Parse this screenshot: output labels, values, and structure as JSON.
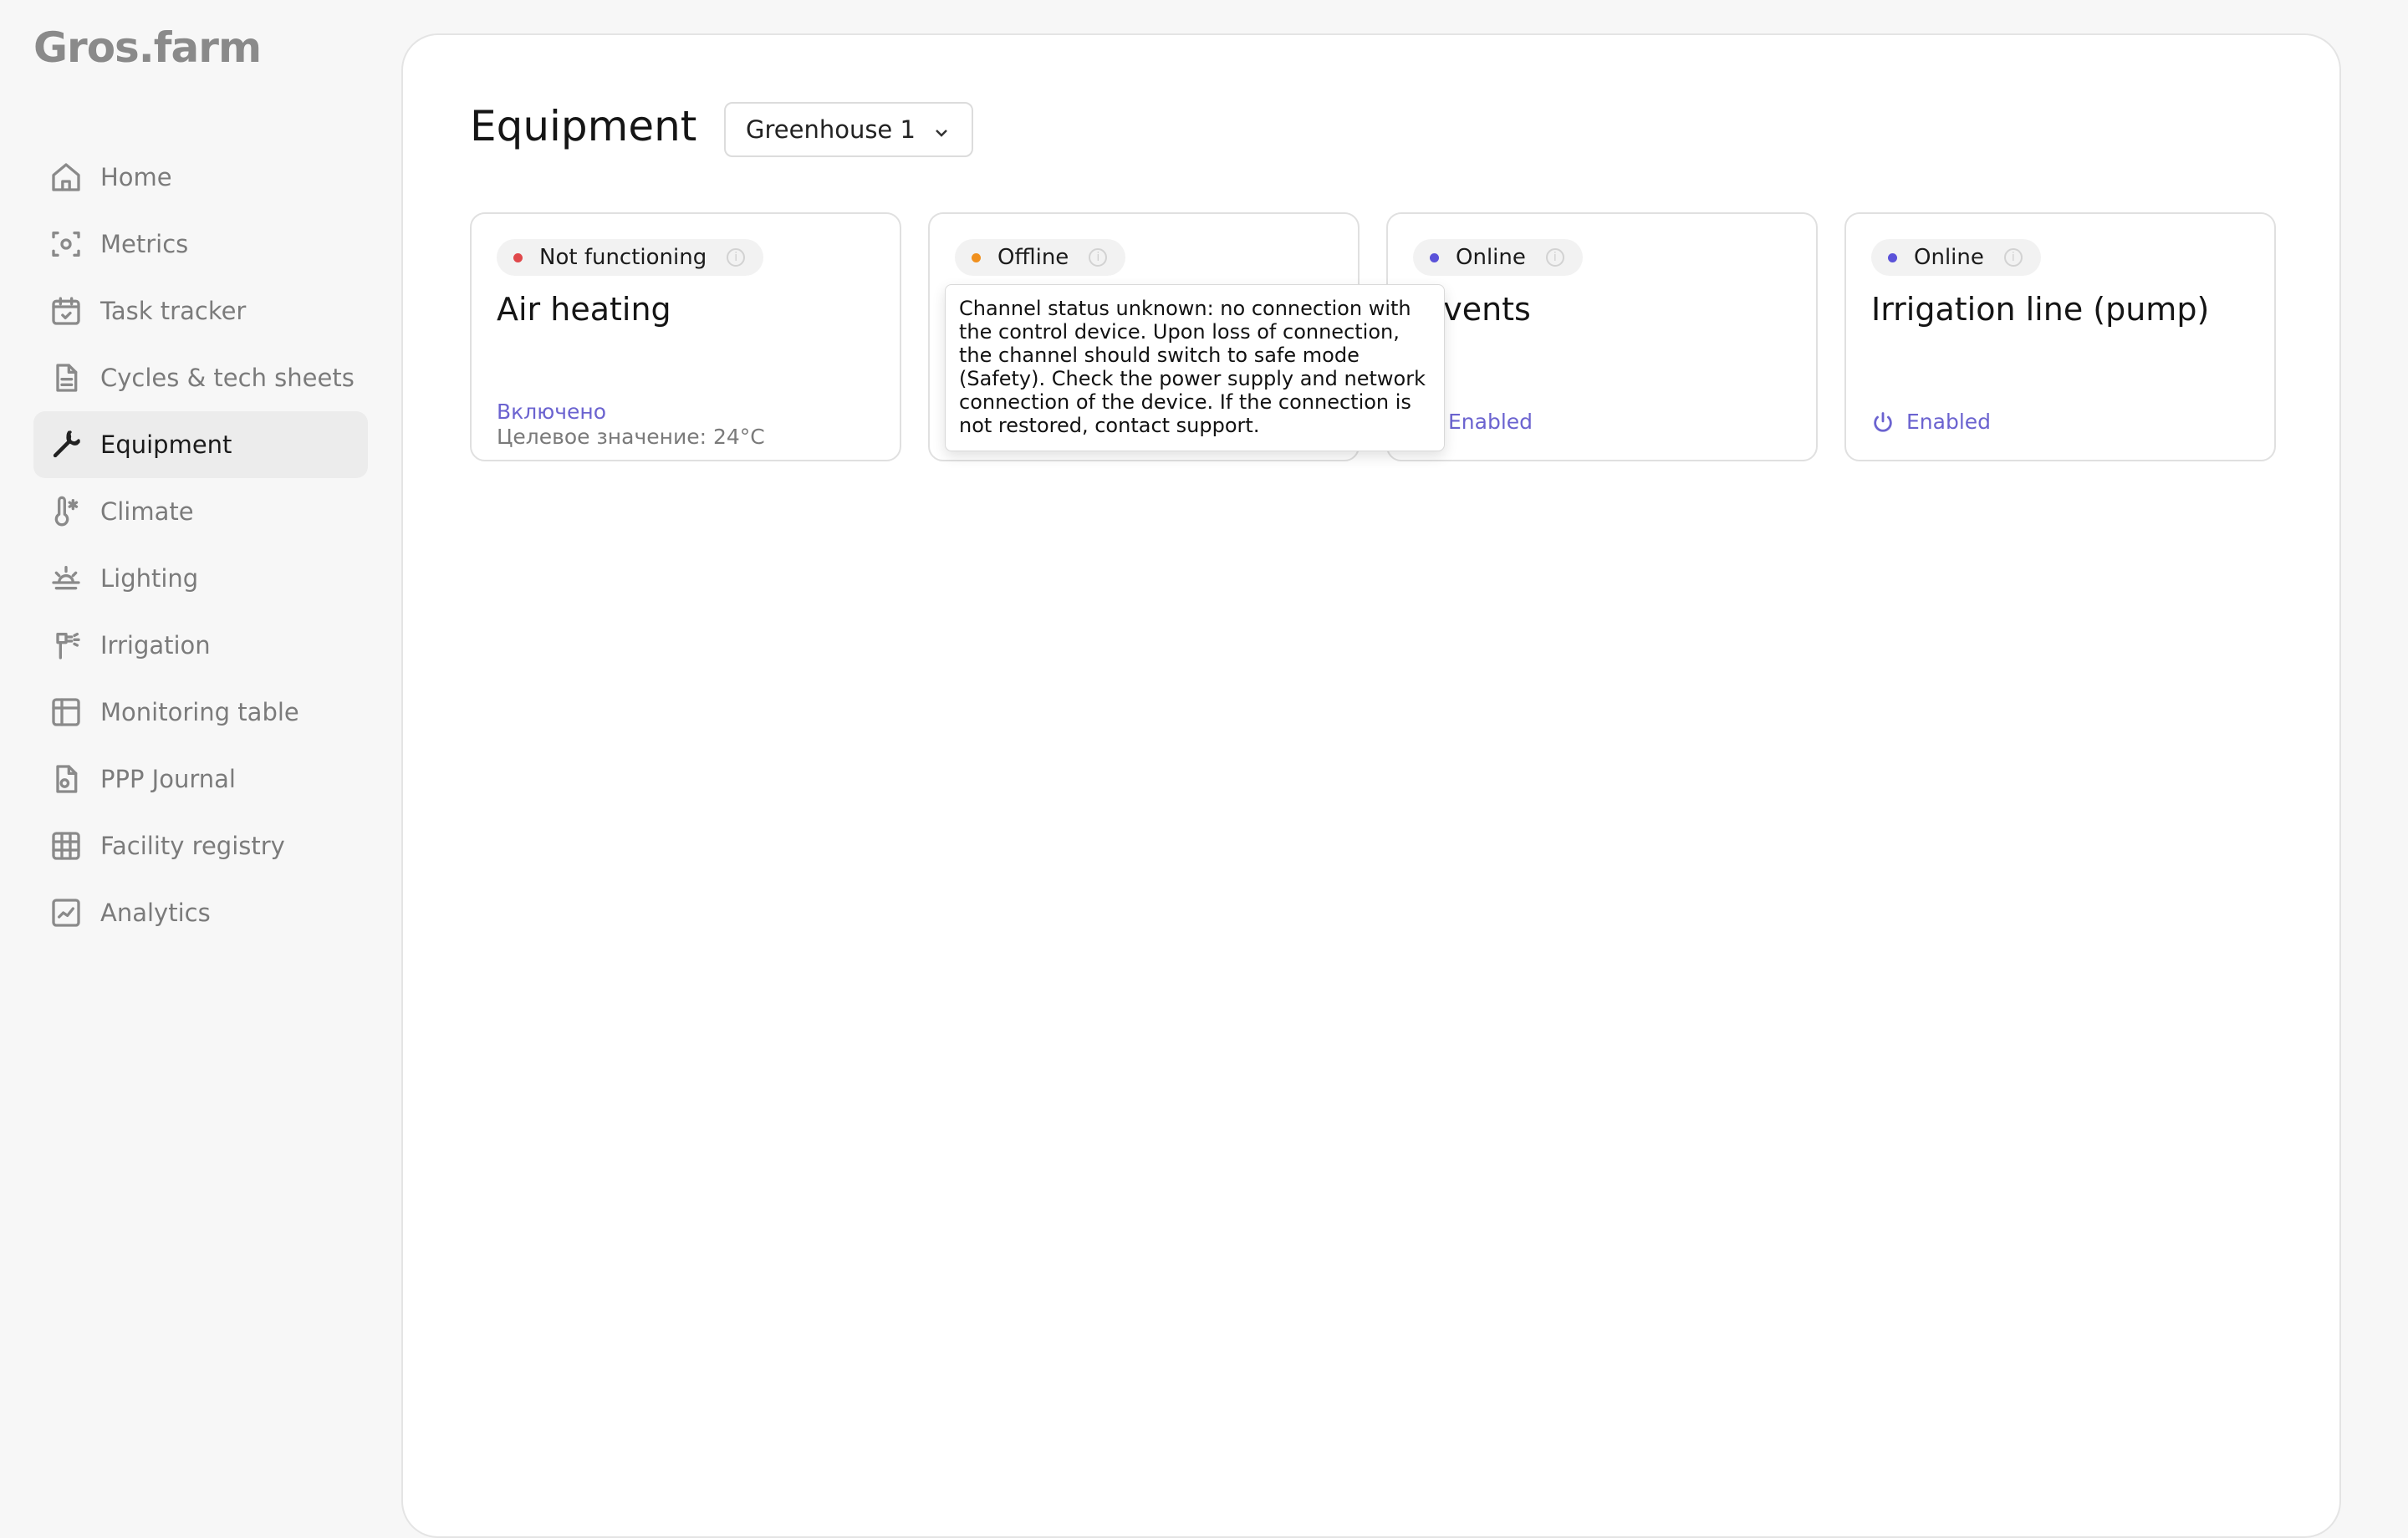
{
  "app": {
    "logo": "Gros.farm"
  },
  "sidebar": {
    "items": [
      {
        "label": "Home",
        "icon": "home-icon"
      },
      {
        "label": "Metrics",
        "icon": "metrics-icon"
      },
      {
        "label": "Task tracker",
        "icon": "calendar-icon"
      },
      {
        "label": "Cycles & tech sheets",
        "icon": "document-icon"
      },
      {
        "label": "Equipment",
        "icon": "wrench-icon",
        "active": true
      },
      {
        "label": "Climate",
        "icon": "thermometer-icon"
      },
      {
        "label": "Lighting",
        "icon": "sunrise-icon"
      },
      {
        "label": "Irrigation",
        "icon": "sprinkler-icon"
      },
      {
        "label": "Monitoring table",
        "icon": "table-icon"
      },
      {
        "label": "PPP Journal",
        "icon": "journal-icon"
      },
      {
        "label": "Facility registry",
        "icon": "grid-icon"
      },
      {
        "label": "Analytics",
        "icon": "chart-icon"
      }
    ]
  },
  "header": {
    "title": "Equipment",
    "greenhouse_select": {
      "value": "Greenhouse 1"
    }
  },
  "cards": [
    {
      "status": "Not functioning",
      "status_color": "#e0484b",
      "title": "Air heating",
      "state_label": "Включено",
      "target_label": "Целевое значение: 24°C"
    },
    {
      "status": "Offline",
      "status_color": "#f0901e",
      "title": ""
    },
    {
      "status": "Online",
      "status_color": "#5b52d9",
      "title": "p vents",
      "state_label": "Enabled"
    },
    {
      "status": "Online",
      "status_color": "#5b52d9",
      "title": "Irrigation line (pump)",
      "state_label": "Enabled"
    }
  ],
  "tooltip": {
    "text": "Channel status unknown: no connection with the control device. Upon loss of connection, the channel should switch to safe mode (Safety). Check the power supply and network connection of the device. If the connection is not restored, contact support."
  },
  "colors": {
    "accent": "#6b63d0",
    "active_nav_bg": "#ececec"
  }
}
